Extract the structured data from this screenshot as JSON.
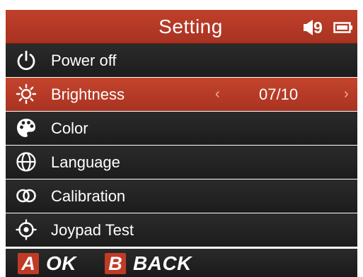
{
  "header": {
    "title": "Setting",
    "volume_icon": "speaker-icon",
    "volume_level": "9",
    "battery_icon": "battery-icon"
  },
  "menu": {
    "items": [
      {
        "label": "Power off",
        "icon": "power-icon",
        "selected": false
      },
      {
        "label": "Brightness",
        "icon": "brightness-icon",
        "selected": true,
        "value": "07/10",
        "left_arrow": "‹",
        "right_arrow": "›"
      },
      {
        "label": "Color",
        "icon": "palette-icon",
        "selected": false
      },
      {
        "label": "Language",
        "icon": "globe-icon",
        "selected": false
      },
      {
        "label": "Calibration",
        "icon": "calibration-icon",
        "selected": false
      },
      {
        "label": "Joypad Test",
        "icon": "crosshair-icon",
        "selected": false
      }
    ]
  },
  "footer": {
    "ok_key": "A",
    "ok_label": "OK",
    "back_key": "B",
    "back_label": "BACK"
  },
  "colors": {
    "accent": "#b83a26",
    "row_background": "#222222",
    "text": "#ffffff"
  }
}
